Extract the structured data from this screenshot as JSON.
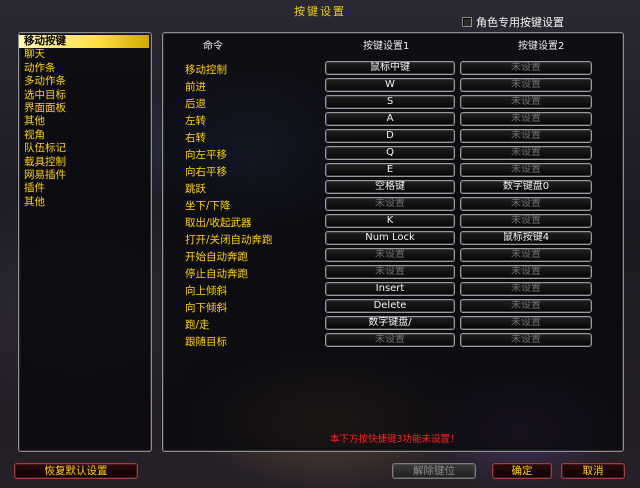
{
  "window": {
    "title": "按键设置",
    "char_specific_label": "角色专用按键设置"
  },
  "sidebar": {
    "items": [
      {
        "label": "移动按键",
        "selected": true
      },
      {
        "label": "聊天"
      },
      {
        "label": "动作条"
      },
      {
        "label": "多动作条"
      },
      {
        "label": "选中目标"
      },
      {
        "label": "界面面板"
      },
      {
        "label": "其他"
      },
      {
        "label": "视角"
      },
      {
        "label": "队伍标记"
      },
      {
        "label": "载具控制"
      },
      {
        "label": "网易插件"
      },
      {
        "label": "插件"
      },
      {
        "label": "其他"
      }
    ]
  },
  "table": {
    "headers": {
      "command": "命令",
      "key1": "按键设置1",
      "key2": "按键设置2"
    },
    "rows": [
      {
        "cmd": "移动控制",
        "k1": "鼠标中键",
        "k2": "未设置"
      },
      {
        "cmd": "前进",
        "k1": "W",
        "k2": "未设置"
      },
      {
        "cmd": "后退",
        "k1": "S",
        "k2": "未设置"
      },
      {
        "cmd": "左转",
        "k1": "A",
        "k2": "未设置"
      },
      {
        "cmd": "右转",
        "k1": "D",
        "k2": "未设置"
      },
      {
        "cmd": "向左平移",
        "k1": "Q",
        "k2": "未设置"
      },
      {
        "cmd": "向右平移",
        "k1": "E",
        "k2": "未设置"
      },
      {
        "cmd": "跳跃",
        "k1": "空格键",
        "k2": "数字键盘0"
      },
      {
        "cmd": "坐下/下降",
        "k1": "未设置",
        "k2": "未设置"
      },
      {
        "cmd": "取出/收起武器",
        "k1": "K",
        "k2": "未设置"
      },
      {
        "cmd": "打开/关闭自动奔跑",
        "k1": "Num Lock",
        "k2": "鼠标按键4"
      },
      {
        "cmd": "开始自动奔跑",
        "k1": "未设置",
        "k2": "未设置"
      },
      {
        "cmd": "停止自动奔跑",
        "k1": "未设置",
        "k2": "未设置"
      },
      {
        "cmd": "向上倾斜",
        "k1": "Insert",
        "k2": "未设置"
      },
      {
        "cmd": "向下倾斜",
        "k1": "Delete",
        "k2": "未设置"
      },
      {
        "cmd": "跑/走",
        "k1": "数字键盘/",
        "k2": "未设置"
      },
      {
        "cmd": "跟随目标",
        "k1": "未设置",
        "k2": "未设置"
      }
    ],
    "unset_text": "未设置"
  },
  "warning": "本下方按快捷键3功能未设置！",
  "buttons": {
    "reset": "恢复默认设置",
    "unbind": "解除键位",
    "ok": "确定",
    "cancel": "取消"
  },
  "colors": {
    "accent": "#ffd200",
    "warning": "#ff2020",
    "selected_bg": "#ffe040"
  }
}
